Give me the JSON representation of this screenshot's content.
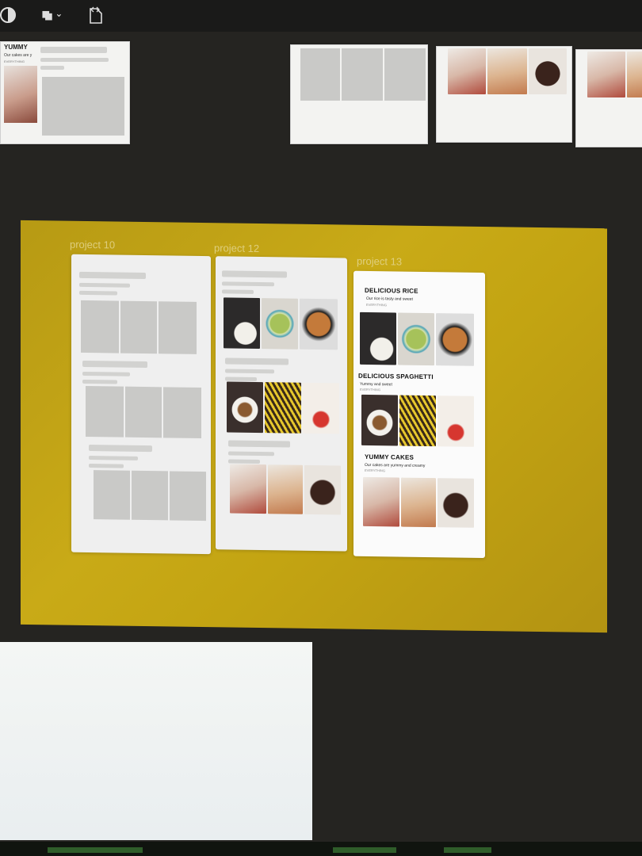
{
  "toolbar": {
    "icons": [
      "contrast-icon",
      "pages-icon",
      "code-icon"
    ]
  },
  "thumbnails": {
    "first": {
      "title": "YUMMY",
      "subtitle": "Our cakes are y",
      "small": "EVERYTHING"
    }
  },
  "frame": {
    "labels": [
      "project 10",
      "project 12",
      "project 13"
    ]
  },
  "project13": {
    "sections": [
      {
        "title": "DELICIOUS RICE",
        "subtitle": "Our rice is tasty and sweet",
        "small": "EVERYTHING"
      },
      {
        "title": "DELICIOUS SPAGHETTI",
        "subtitle": "Yummy and sweet",
        "small": "EVERYTHING"
      },
      {
        "title": "YUMMY CAKES",
        "subtitle": "Our cakes are yummy and creamy",
        "small": "EVERYTHING"
      }
    ]
  },
  "colors": {
    "frame": "#c3a412",
    "canvas": "#252421",
    "card": "#f7f7f7"
  }
}
